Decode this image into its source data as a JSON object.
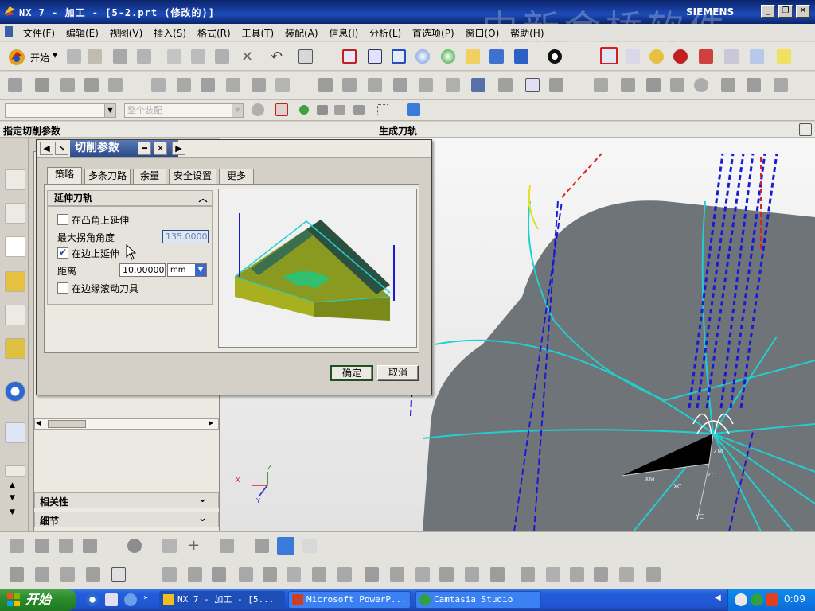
{
  "window": {
    "title": "NX 7 - 加工 - [5-2.prt (修改的)]",
    "brand": "SIEMENS",
    "watermark": "中新金桥软件"
  },
  "menu": [
    "文件(F)",
    "编辑(E)",
    "视图(V)",
    "插入(S)",
    "格式(R)",
    "工具(T)",
    "装配(A)",
    "信息(I)",
    "分析(L)",
    "首选项(P)",
    "窗口(O)",
    "帮助(H)"
  ],
  "toolbar": {
    "start_label": "开始"
  },
  "selection_bar": {
    "filter_value": "",
    "scope_value": "整个装配"
  },
  "status": {
    "prompt": "指定切削参数",
    "message": "生成刀轨"
  },
  "navigator": {
    "section_related": "相关性",
    "section_details": "细节"
  },
  "dialog": {
    "title": "切削参数",
    "tabs": [
      "策略",
      "多条刀路",
      "余量",
      "安全设置",
      "更多"
    ],
    "active_tab": "策略",
    "group_title": "延伸刀轨",
    "options": {
      "extend_at_convex_corners": {
        "label": "在凸角上延伸",
        "checked": false
      },
      "max_corner_angle": {
        "label": "最大拐角角度",
        "value": "135.00000"
      },
      "extend_at_edges": {
        "label": "在边上延伸",
        "checked": true
      },
      "distance": {
        "label": "距离",
        "value": "10.00000",
        "unit": "mm"
      },
      "roll_tool_over_edges": {
        "label": "在边缘滚动刀具",
        "checked": false
      }
    },
    "ok_label": "确定",
    "cancel_label": "取消"
  },
  "wcs_labels": {
    "x": "X",
    "y": "Y",
    "z": "Z",
    "xm": "XM",
    "ym": "YM",
    "zm": "ZM",
    "xc": "XC",
    "yc": "YC",
    "zc": "ZC"
  },
  "taskbar": {
    "start_label": "开始",
    "tasks": [
      "NX 7 - 加工 - [5...",
      "Microsoft PowerP...",
      "Camtasia Studio"
    ],
    "clock": "0:09"
  },
  "colors": {
    "title_blue": "#0a246a",
    "toolpath_blue": "#1a1ad6",
    "toolpath_cyan": "#20d0d0",
    "model_gray": "#6e7478",
    "taskbar_blue": "#245edc"
  }
}
